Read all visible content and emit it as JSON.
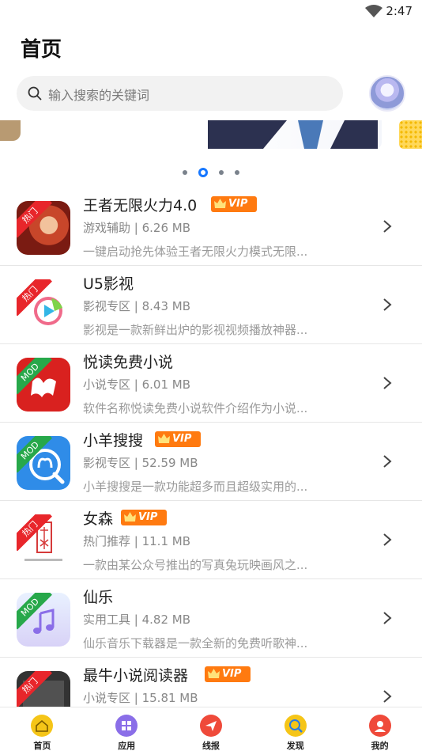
{
  "status": {
    "time": "2:47"
  },
  "header": {
    "title": "首页"
  },
  "search": {
    "placeholder": "输入搜索的关键词"
  },
  "apps": [
    {
      "name": "王者无限火力4.0",
      "vip": true,
      "badge": "热门",
      "meta": "游戏辅助 | 6.26 MB",
      "desc": "一键启动抢先体验王者无限火力模式无限..."
    },
    {
      "name": "U5影视",
      "vip": false,
      "badge": "热门",
      "meta": "影视专区 | 8.43 MB",
      "desc": "影视是一款新鲜出炉的影视视频播放神器..."
    },
    {
      "name": "悦读免费小说",
      "vip": false,
      "badge": "MOD",
      "meta": "小说专区 | 6.01 MB",
      "desc": "软件名称悦读免费小说软件介绍作为小说..."
    },
    {
      "name": "小羊搜搜",
      "vip": true,
      "badge": "MOD",
      "meta": "影视专区 | 52.59 MB",
      "desc": "小羊搜搜是一款功能超多而且超级实用的..."
    },
    {
      "name": "女森",
      "vip": true,
      "badge": "热门",
      "meta": "热门推荐 | 11.1 MB",
      "desc": "一款由某公众号推出的写真兔玩映画风之..."
    },
    {
      "name": "仙乐",
      "vip": false,
      "badge": "MOD",
      "meta": "实用工具 | 4.82 MB",
      "desc": "仙乐音乐下载器是一款全新的免费听歌神..."
    },
    {
      "name": "最牛小说阅读器",
      "vip": true,
      "badge": "热门",
      "meta": "小说专区 | 15.81 MB",
      "desc": ""
    }
  ],
  "vip_label": "VIP",
  "tabs": [
    {
      "label": "首页",
      "icon": "home-icon",
      "color": "#f5c518"
    },
    {
      "label": "应用",
      "icon": "apps-icon",
      "color": "#8a6ee8"
    },
    {
      "label": "线报",
      "icon": "send-icon",
      "color": "#ef4a3a"
    },
    {
      "label": "发现",
      "icon": "discover-icon",
      "color": "#f5c518"
    },
    {
      "label": "我的",
      "icon": "profile-icon",
      "color": "#ef4a3a"
    }
  ],
  "colors": {
    "accent": "#1677ff",
    "vip": "#ff7a10",
    "hot": "#e8262b",
    "mod": "#27a84a"
  }
}
